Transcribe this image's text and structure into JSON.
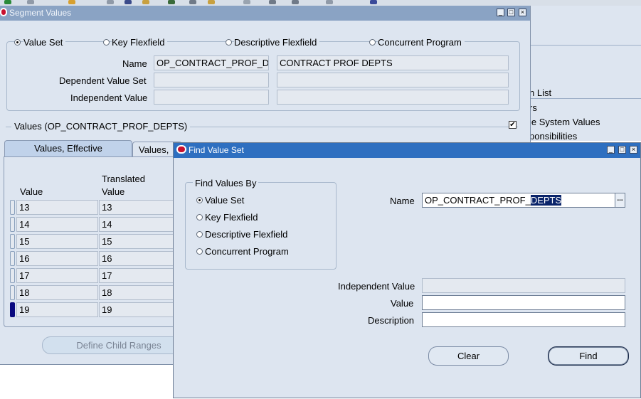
{
  "background_window": {
    "items": [
      "n List",
      "rs",
      "le System Values",
      "ponsibilities"
    ]
  },
  "segment_values": {
    "title": "Segment Values",
    "radios": [
      {
        "label": "Value Set",
        "checked": true
      },
      {
        "label": "Key Flexfield",
        "checked": false
      },
      {
        "label": "Descriptive Flexfield",
        "checked": false
      },
      {
        "label": "Concurrent Program",
        "checked": false
      }
    ],
    "name_label": "Name",
    "name_value": "OP_CONTRACT_PROF_DE",
    "name_desc": "CONTRACT PROF DEPTS",
    "dependent_label": "Dependent Value Set",
    "independent_label": "Independent Value",
    "values_header": "Values (OP_CONTRACT_PROF_DEPTS)",
    "values_checked": true,
    "tabs": [
      "Values, Effective",
      "Values, "
    ],
    "col_value": "Value",
    "col_translated_line1": "Translated",
    "col_translated_line2": "Value",
    "rows": [
      {
        "value": "13",
        "translated": "13"
      },
      {
        "value": "14",
        "translated": "14"
      },
      {
        "value": "15",
        "translated": "15"
      },
      {
        "value": "16",
        "translated": "16"
      },
      {
        "value": "17",
        "translated": "17"
      },
      {
        "value": "18",
        "translated": "18"
      },
      {
        "value": "19",
        "translated": "19"
      }
    ],
    "define_child_ranges": "Define Child Ranges"
  },
  "find_dialog": {
    "title": "Find Value Set",
    "group_label": "Find Values By",
    "radios": [
      {
        "label": "Value Set",
        "checked": true
      },
      {
        "label": "Key Flexfield",
        "checked": false
      },
      {
        "label": "Descriptive Flexfield",
        "checked": false
      },
      {
        "label": "Concurrent Program",
        "checked": false
      }
    ],
    "name_label": "Name",
    "name_value_prefix": "OP_CONTRACT_PROF_",
    "name_value_selected": "DEPTS",
    "lov_button": "...",
    "independent_label": "Independent Value",
    "value_label": "Value",
    "description_label": "Description",
    "clear_button": "Clear",
    "find_button": "Find"
  },
  "colors": {
    "window_bg": "#dde5f0",
    "active_title": "#2e6fc0",
    "inactive_title": "#8aa3c4",
    "selection": "#0a246a"
  }
}
